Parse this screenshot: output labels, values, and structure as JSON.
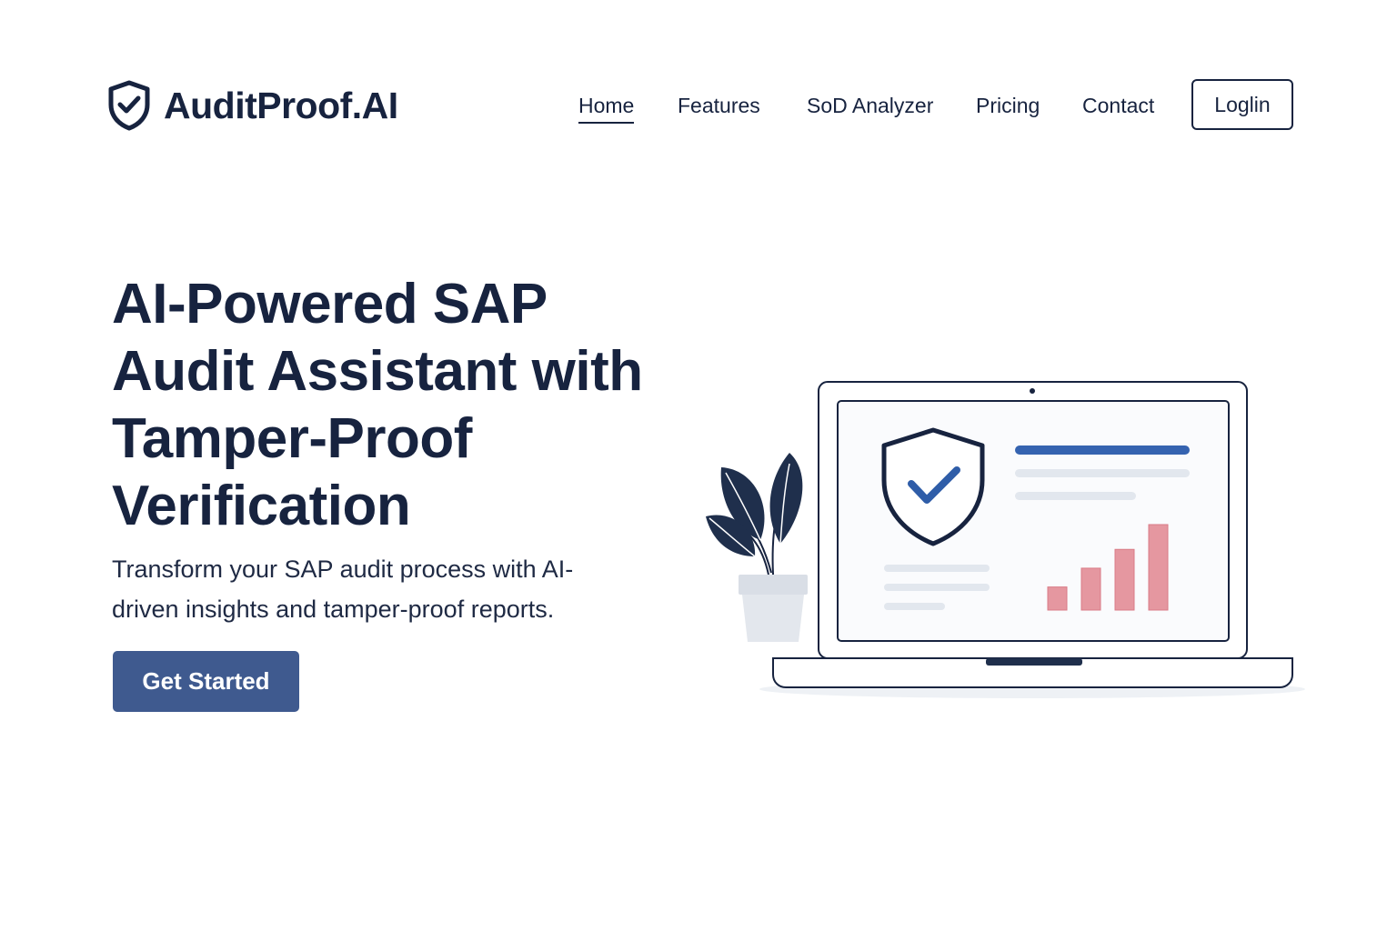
{
  "brand": {
    "name": "AuditProof.AI",
    "icon": "shield-check-icon"
  },
  "nav": {
    "items": [
      {
        "label": "Home",
        "active": true
      },
      {
        "label": "Features",
        "active": false
      },
      {
        "label": "SoD Analyzer",
        "active": false
      },
      {
        "label": "Pricing",
        "active": false
      },
      {
        "label": "Contact",
        "active": false
      }
    ],
    "login_label": "Loglin"
  },
  "hero": {
    "title_lines": [
      "AI-Powered SAP",
      "Audit Assistant with",
      "Tamper-Proof",
      "Verification"
    ],
    "subtitle_lines": [
      "Transform your SAP audit process with AI-",
      "driven insights and tamper-proof reports."
    ],
    "cta_label": "Get Started"
  },
  "illustration": {
    "icons": [
      "laptop-icon",
      "shield-check-icon",
      "bar-chart-icon",
      "plant-icon"
    ],
    "bar_levels": [
      0.27,
      0.49,
      0.71,
      1.0
    ]
  },
  "colors": {
    "text": "#17233f",
    "accent": "#3f5a8f",
    "shield_check": "#2f5da8",
    "bars": "#e597a0",
    "placeholder_lines": "#e2e7ee"
  }
}
